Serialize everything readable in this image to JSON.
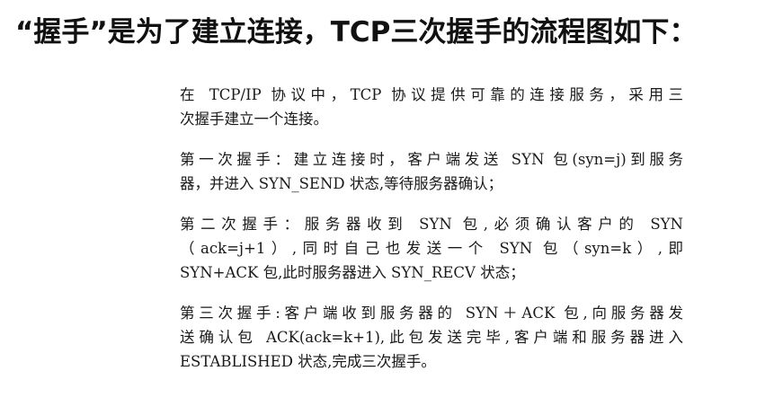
{
  "title": "“握手”是为了建立连接，TCP三次握手的流程图如下：",
  "document": {
    "paragraphs": [
      {
        "lines": [
          "在 TCP/IP 协议中，TCP 协议提供可靠的连接服务，采用三",
          "次握手建立一个连接。"
        ]
      },
      {
        "lines": [
          "第一次握手：建立连接时，客户端发送 SYN 包(syn=j)到服务",
          "器，并进入 SYN_SEND 状态,等待服务器确认；"
        ]
      },
      {
        "lines": [
          "第二次握手：服务器收到 SYN 包,必须确认客户的 SYN",
          "（ack=j+1）,同时自己也发送一个 SYN 包（syn=k）,即",
          "SYN+ACK 包,此时服务器进入 SYN_RECV 状态；"
        ]
      },
      {
        "lines": [
          "第三次握手:客户端收到服务器的 SYN＋ACK 包,向服务器发",
          "送确认包 ACK(ack=k+1),此包发送完毕,客户端和服务器进入",
          "ESTABLISHED 状态,完成三次握手。"
        ]
      }
    ]
  }
}
